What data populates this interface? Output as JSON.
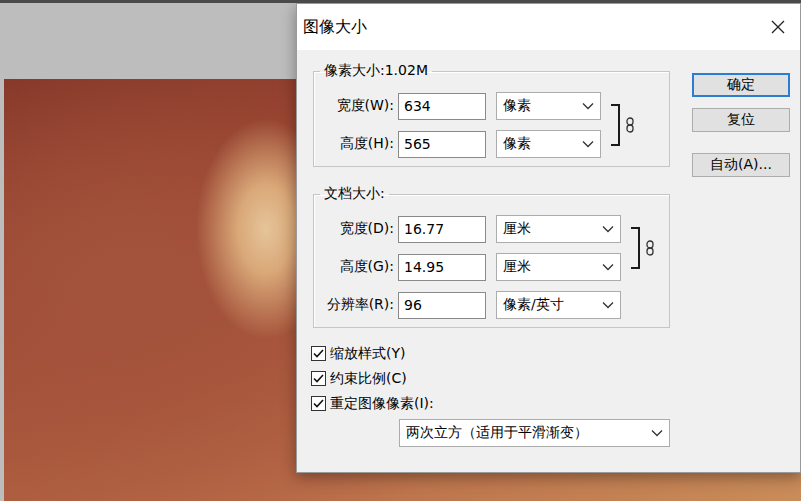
{
  "window": {
    "title": "图像大小"
  },
  "pixel_dimensions": {
    "legend": "像素大小:1.02M",
    "fields": [
      {
        "label": "宽度(W):",
        "value": "634",
        "unit": "像素",
        "linked": true
      },
      {
        "label": "高度(H):",
        "value": "565",
        "unit": "像素",
        "linked": true
      }
    ]
  },
  "document_size": {
    "legend": "文档大小:",
    "fields": [
      {
        "label": "宽度(D):",
        "value": "16.77",
        "unit": "厘米",
        "linked": true
      },
      {
        "label": "高度(G):",
        "value": "14.95",
        "unit": "厘米",
        "linked": true
      },
      {
        "label": "分辨率(R):",
        "value": "96",
        "unit": "像素/英寸",
        "linked": false
      }
    ]
  },
  "buttons": [
    {
      "label": "确定",
      "default": true
    },
    {
      "label": "复位",
      "default": false
    },
    {
      "label": "自动(A)...",
      "default": false
    }
  ],
  "options": [
    {
      "label": "缩放样式(Y)",
      "checked": true
    },
    {
      "label": "约束比例(C)",
      "checked": true
    },
    {
      "label": "重定图像像素(I):",
      "checked": true
    }
  ],
  "resample_method": "两次立方（适用于平滑渐变）"
}
